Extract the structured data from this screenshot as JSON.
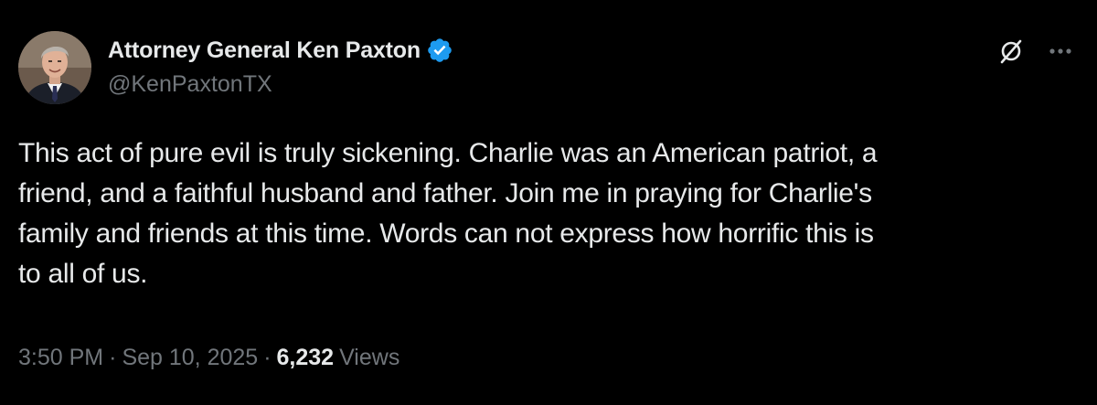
{
  "author": {
    "display_name": "Attorney General Ken Paxton",
    "handle": "@KenPaxtonTX",
    "verified": true,
    "verified_color": "#1d9bf0"
  },
  "icons": {
    "grok": "grok-icon",
    "more": "more-options-icon",
    "verified": "verified-badge-icon"
  },
  "tweet": {
    "text": "This act of pure evil is truly sickening. Charlie was an American patriot, a\nfriend, and a faithful husband and father. Join me in praying for Charlie's\nfamily and friends at this time. Words can not express how horrific this is\nto all of us.",
    "time": "3:50 PM",
    "separator": "·",
    "date": "Sep 10, 2025",
    "views_count": "6,232",
    "views_label": "Views"
  },
  "colors": {
    "background": "#000000",
    "primary_text": "#e7e9ea",
    "secondary_text": "#71767b"
  }
}
